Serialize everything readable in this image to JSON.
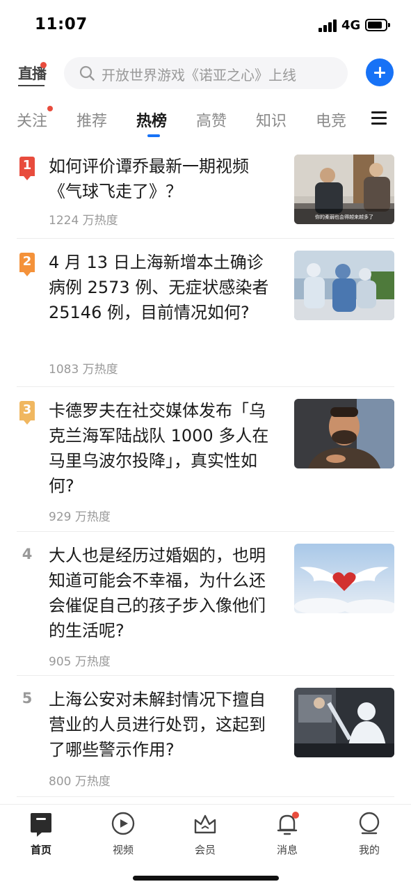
{
  "status_bar": {
    "time": "11:07",
    "network": "4G"
  },
  "header": {
    "live_label": "直播",
    "search_placeholder": "开放世界游戏《诺亚之心》上线"
  },
  "tabs": [
    {
      "label": "关注",
      "has_dot": true
    },
    {
      "label": "推荐"
    },
    {
      "label": "热榜",
      "active": true
    },
    {
      "label": "高赞"
    },
    {
      "label": "知识"
    },
    {
      "label": "电竞"
    }
  ],
  "hot_list": [
    {
      "rank": "1",
      "title": "如何评价谭乔最新一期视频《气球飞走了》？",
      "heat": "1224 万热度",
      "thumb": "two-men-talking",
      "thumb_caption": "你的柔弱也会得越来越多了"
    },
    {
      "rank": "2",
      "title": "4 月 13 日上海新增本土确诊病例 2573 例、无症状感染者 25146 例，目前情况如何?",
      "heat": "1083 万热度",
      "thumb": "medical-workers"
    },
    {
      "rank": "3",
      "title": "卡德罗夫在社交媒体发布「乌克兰海军陆战队 1000 多人在马里乌波尔投降」，真实性如何?",
      "heat": "929 万热度",
      "thumb": "man-portrait"
    },
    {
      "rank": "4",
      "title": "大人也是经历过婚姻的，也明知道可能会不幸福，为什么还会催促自己的孩子步入像他们的生活呢?",
      "heat": "905 万热度",
      "thumb": "winged-heart"
    },
    {
      "rank": "5",
      "title": "上海公安对未解封情况下擅自营业的人员进行处罚，这起到了哪些警示作用?",
      "heat": "800 万热度",
      "thumb": "police-scene"
    }
  ],
  "bottom_nav": [
    {
      "label": "首页",
      "icon": "home-icon",
      "active": true
    },
    {
      "label": "视频",
      "icon": "video-icon"
    },
    {
      "label": "会员",
      "icon": "crown-icon"
    },
    {
      "label": "消息",
      "icon": "bell-icon",
      "has_dot": true
    },
    {
      "label": "我的",
      "icon": "profile-icon"
    }
  ],
  "colors": {
    "accent": "#1772f6",
    "rank1": "#e84c3d",
    "rank2": "#f4923a",
    "rank3": "#f0b760",
    "dot": "#e84c3d"
  }
}
